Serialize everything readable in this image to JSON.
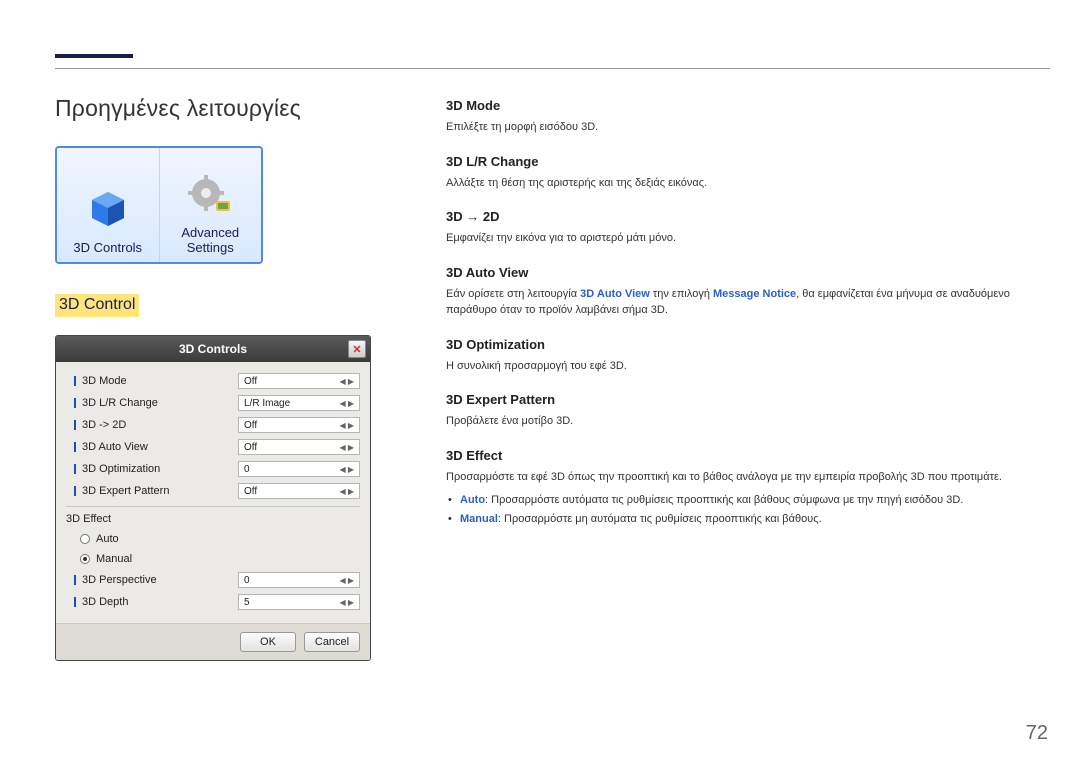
{
  "page_title": "Προηγμένες λειτουργίες",
  "icon_row": {
    "controls_label": "3D Controls",
    "advanced_label_line1": "Advanced",
    "advanced_label_line2": "Settings"
  },
  "section_label": "3D Control",
  "dialog": {
    "title": "3D Controls",
    "close_glyph": "✕",
    "options": [
      {
        "label": "3D Mode",
        "value": "Off"
      },
      {
        "label": "3D L/R Change",
        "value": "L/R Image"
      },
      {
        "label": "3D -> 2D",
        "value": "Off"
      },
      {
        "label": "3D Auto View",
        "value": "Off"
      },
      {
        "label": "3D Optimization",
        "value": "0"
      },
      {
        "label": "3D Expert Pattern",
        "value": "Off"
      }
    ],
    "effect_group": "3D Effect",
    "radio_auto": "Auto",
    "radio_manual": "Manual",
    "sub_options": [
      {
        "label": "3D Perspective",
        "value": "0"
      },
      {
        "label": "3D Depth",
        "value": "5"
      }
    ],
    "ok": "OK",
    "cancel": "Cancel"
  },
  "right": {
    "h_mode": "3D Mode",
    "p_mode": "Επιλέξτε τη μορφή εισόδου 3D.",
    "h_lr": "3D L/R Change",
    "p_lr": "Αλλάξτε τη θέση της αριστερής και της δεξιάς εικόνας.",
    "h_2d": "3D → 2D",
    "p_2d": "Εμφανίζει την εικόνα για το αριστερό μάτι μόνο.",
    "h_auto": "3D Auto View",
    "p_auto_pre": "Εάν ορίσετε στη λειτουργία ",
    "p_auto_b1": "3D Auto View",
    "p_auto_mid": " την επιλογή ",
    "p_auto_b2": "Message Notice",
    "p_auto_post": ", θα εμφανίζεται ένα μήνυμα σε αναδυόμενο παράθυρο όταν το προϊόν λαμβάνει σήμα 3D.",
    "h_opt": "3D Optimization",
    "p_opt": "Η συνολική προσαρμογή του εφέ 3D.",
    "h_exp": "3D Expert Pattern",
    "p_exp": "Προβάλετε ένα μοτίβο 3D.",
    "h_eff": "3D Effect",
    "p_eff": "Προσαρμόστε τα εφέ 3D όπως την προοπτική και το βάθος ανάλογα με την εμπειρία προβολής 3D που προτιμάτε.",
    "li_auto_lbl": "Auto",
    "li_auto_txt": ": Προσαρμόστε αυτόματα τις ρυθμίσεις προοπτικής και βάθους σύμφωνα με την πηγή εισόδου 3D.",
    "li_man_lbl": "Manual",
    "li_man_txt": ": Προσαρμόστε μη αυτόματα τις ρυθμίσεις προοπτικής και βάθους."
  },
  "page_number": "72"
}
